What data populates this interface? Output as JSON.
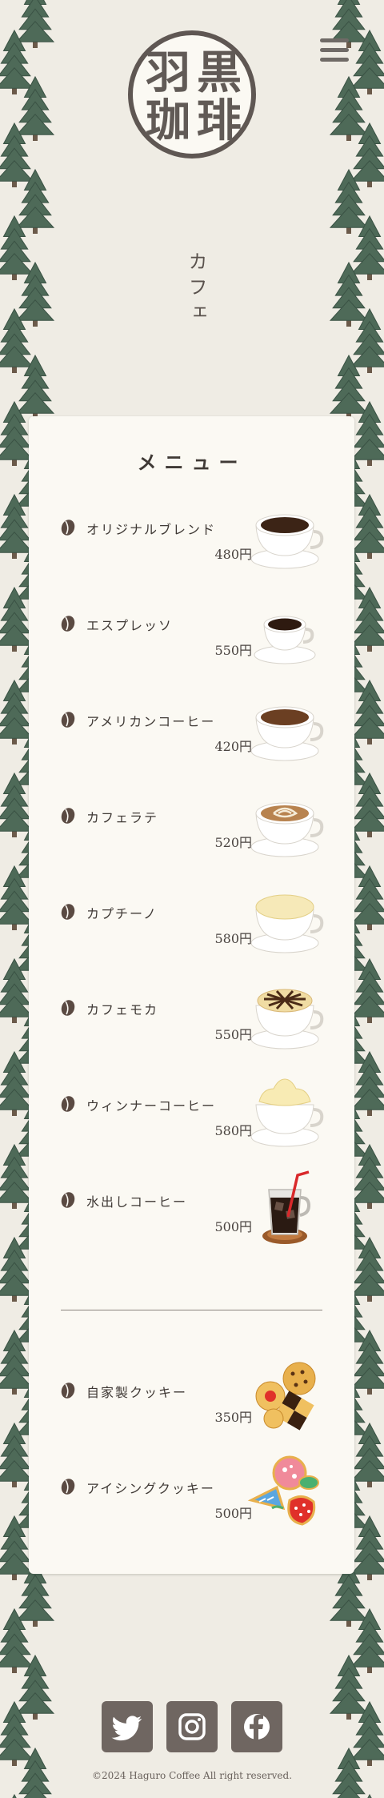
{
  "brand": {
    "logo_chars": [
      "羽",
      "黒",
      "珈",
      "琲"
    ],
    "colors": {
      "accent": "#6f6661",
      "background": "#efece4",
      "card": "#fbf9f3",
      "tree": "#4e6a58"
    }
  },
  "header": {
    "menu_icon": "hamburger-icon"
  },
  "page": {
    "title": "カフェ"
  },
  "menu": {
    "title": "メニュー",
    "drinks": [
      {
        "name": "オリジナルブレンド",
        "price": "480円",
        "image": "blend-coffee-cup"
      },
      {
        "name": "エスプレッソ",
        "price": "550円",
        "image": "espresso-cup"
      },
      {
        "name": "アメリカンコーヒー",
        "price": "420円",
        "image": "american-coffee-cup"
      },
      {
        "name": "カフェラテ",
        "price": "520円",
        "image": "latte-art-cup"
      },
      {
        "name": "カプチーノ",
        "price": "580円",
        "image": "cappuccino-cup"
      },
      {
        "name": "カフェモカ",
        "price": "550円",
        "image": "mocha-cup"
      },
      {
        "name": "ウィンナーコーヒー",
        "price": "580円",
        "image": "vienna-coffee-cup"
      },
      {
        "name": "水出しコーヒー",
        "price": "500円",
        "image": "iced-coffee-glass"
      }
    ],
    "sweets": [
      {
        "name": "自家製クッキー",
        "price": "350円",
        "image": "homemade-cookies"
      },
      {
        "name": "アイシングクッキー",
        "price": "500円",
        "image": "icing-cookies"
      }
    ]
  },
  "footer": {
    "social": [
      {
        "name": "twitter",
        "icon": "twitter-icon"
      },
      {
        "name": "instagram",
        "icon": "instagram-icon"
      },
      {
        "name": "facebook",
        "icon": "facebook-icon"
      }
    ],
    "copyright": "©2024 Haguro Coffee All right reserved."
  }
}
